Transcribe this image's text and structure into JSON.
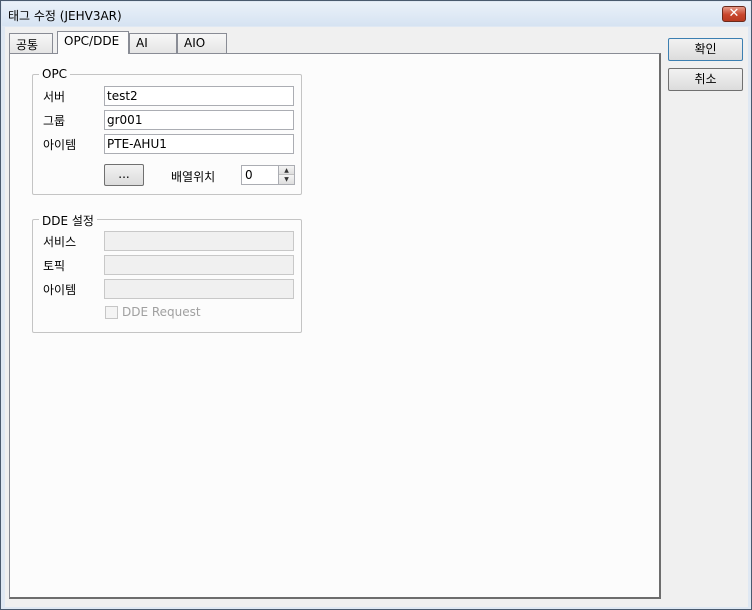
{
  "window": {
    "title": "태그 수정 (JEHV3AR)",
    "close_glyph": "✕"
  },
  "tabs": [
    {
      "label": "공통",
      "active": false
    },
    {
      "label": "OPC/DDE",
      "active": true
    },
    {
      "label": "AI",
      "active": false
    },
    {
      "label": "AIO",
      "active": false
    }
  ],
  "buttons": {
    "ok": "확인",
    "cancel": "취소",
    "browse": "..."
  },
  "opc": {
    "legend": "OPC",
    "server_label": "서버",
    "server_value": "test2",
    "group_label": "그룹",
    "group_value": "gr001",
    "item_label": "아이템",
    "item_value": "PTE-AHU1",
    "array_label": "배열위치",
    "array_value": "0",
    "spin_up": "▲",
    "spin_down": "▼"
  },
  "dde": {
    "legend": "DDE 설정",
    "service_label": "서비스",
    "service_value": "",
    "topic_label": "토픽",
    "topic_value": "",
    "item_label": "아이템",
    "item_value": "",
    "request_label": "DDE Request",
    "request_checked": false
  }
}
